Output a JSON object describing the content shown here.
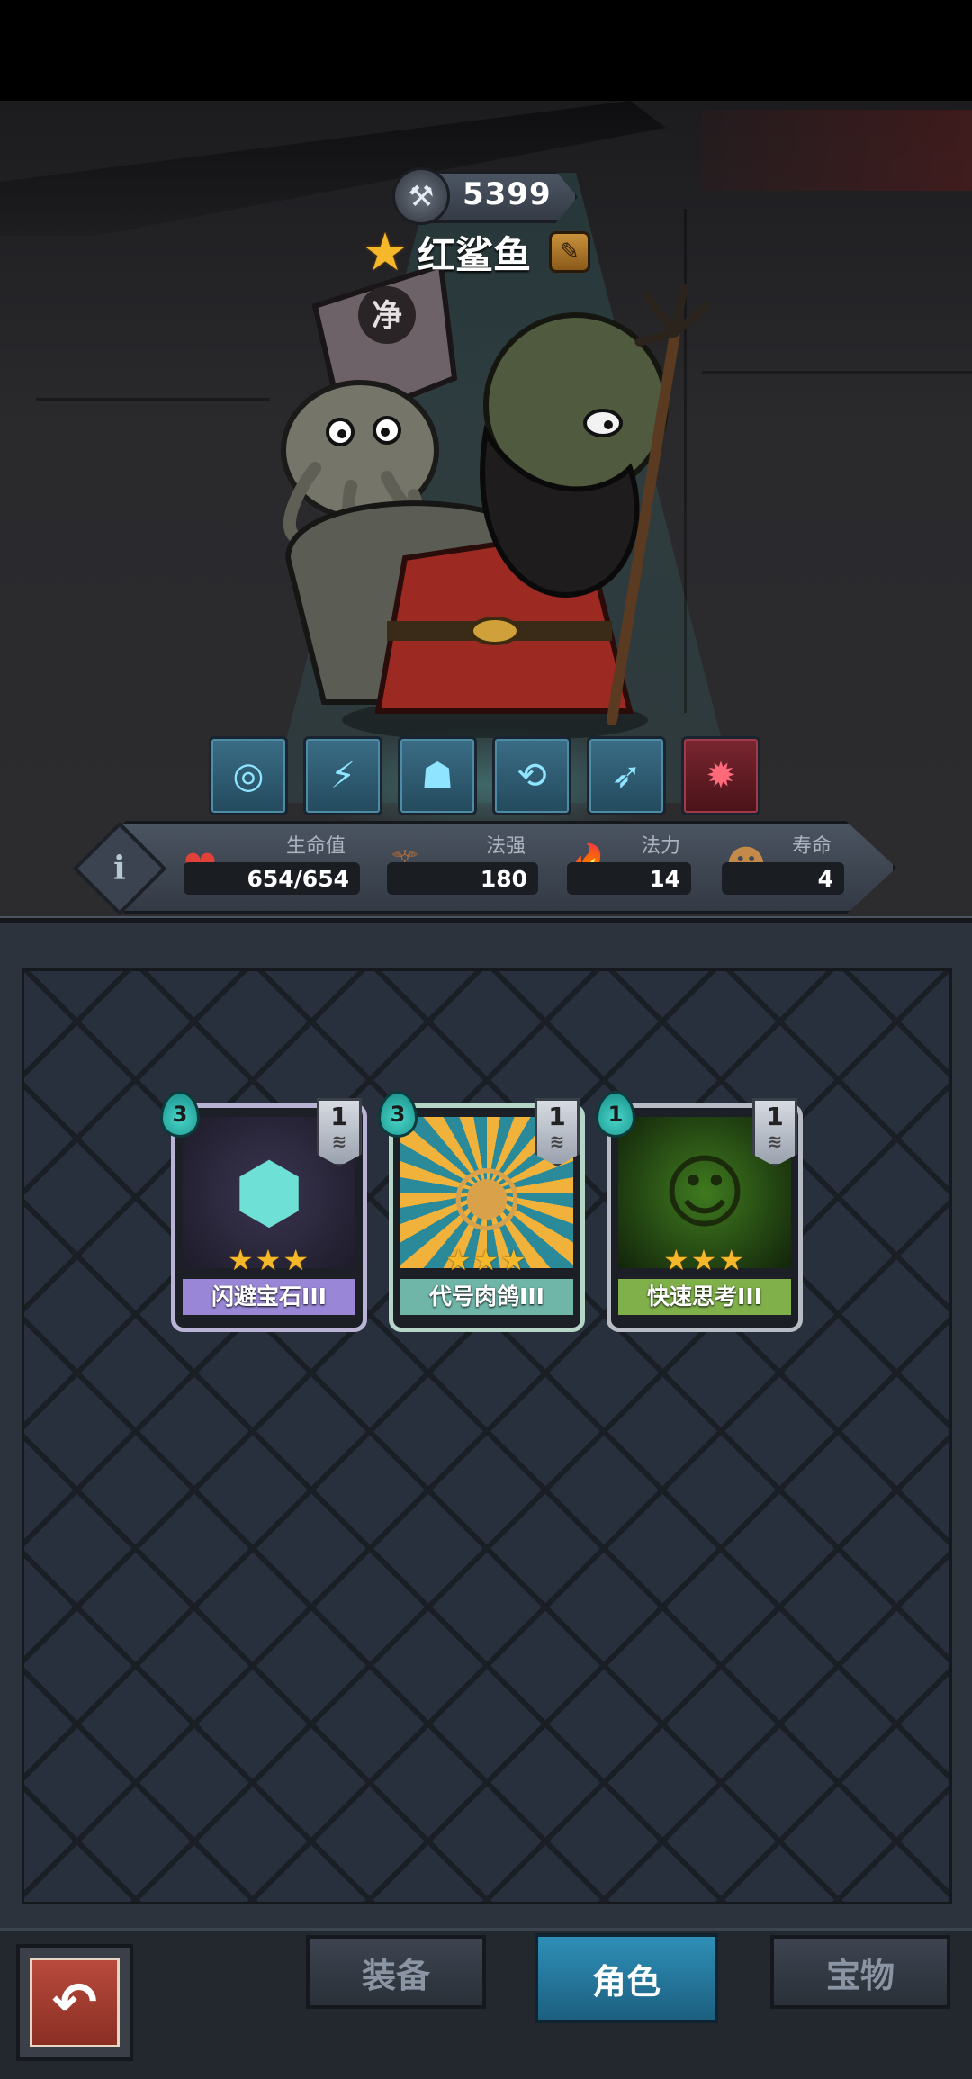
{
  "character": {
    "power": "5399",
    "name": "红鲨鱼",
    "star_color": "#f5b82a"
  },
  "skills": [
    {
      "icon": "vortex-icon"
    },
    {
      "icon": "crack-icon"
    },
    {
      "icon": "hat-icon"
    },
    {
      "icon": "reroll-icon"
    },
    {
      "icon": "dash-icon"
    },
    {
      "icon": "red-rune-icon"
    }
  ],
  "stats": {
    "health": {
      "label": "生命值",
      "value": "654/654"
    },
    "spell_power": {
      "label": "法强",
      "value": "180"
    },
    "mana": {
      "label": "法力",
      "value": "14"
    },
    "lifespan": {
      "label": "寿命",
      "value": "4"
    }
  },
  "cards": [
    {
      "name": "闪避宝石III",
      "cost": "3",
      "level": "1",
      "stars": "★★★",
      "color": "#9a86d6",
      "icon": "gem-icon"
    },
    {
      "name": "代号肉鸽III",
      "cost": "3",
      "level": "1",
      "stars": "★★★",
      "color": "#6fb5a8",
      "icon": "portrait-icon"
    },
    {
      "name": "快速思考III",
      "cost": "1",
      "level": "1",
      "stars": "★★★",
      "color": "#7fb04a",
      "icon": "thinker-icon"
    }
  ],
  "nav": {
    "equipment": "装备",
    "character": "角色",
    "treasure": "宝物"
  },
  "colors": {
    "accent_tab": "#2f8fb7",
    "mana": "#49d6c9"
  }
}
